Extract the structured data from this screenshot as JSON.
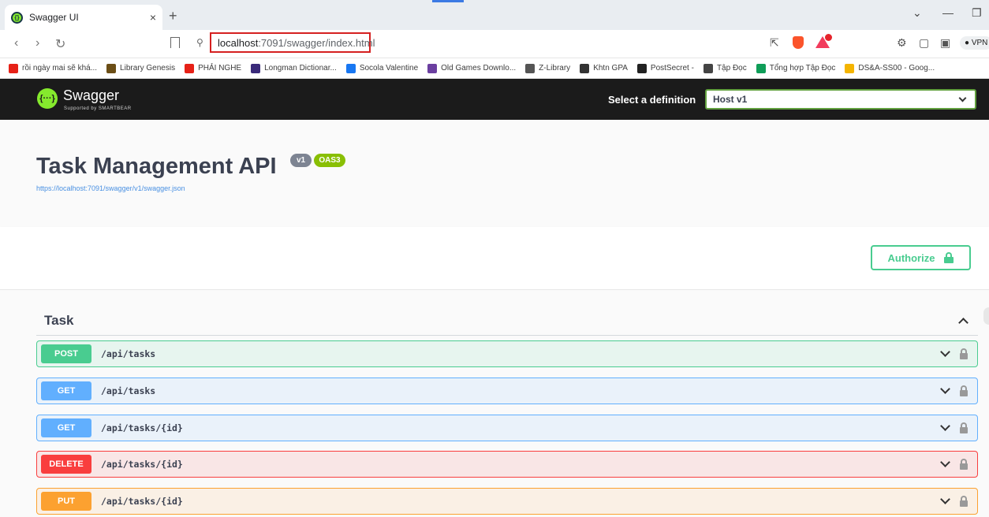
{
  "browser": {
    "tab_title": "Swagger UI",
    "tab_close": "×",
    "new_tab": "+",
    "url_host": "localhost",
    "url_path": ":7091/swagger/index.html",
    "vpn_label": "● VPN",
    "bookmarks": [
      {
        "label": "rồi ngày mai sẽ khá...",
        "color": "#e62117"
      },
      {
        "label": "Library Genesis",
        "color": "#6b4e16"
      },
      {
        "label": "PHẢI NGHE",
        "color": "#e62117"
      },
      {
        "label": "Longman Dictionar...",
        "color": "#3a2a7a"
      },
      {
        "label": "Socola Valentine",
        "color": "#1877f2"
      },
      {
        "label": "Old Games Downlo...",
        "color": "#6b3fa0"
      },
      {
        "label": "Z-Library",
        "color": "#555555"
      },
      {
        "label": "Khtn GPA",
        "color": "#333333"
      },
      {
        "label": "PostSecret -",
        "color": "#222222"
      },
      {
        "label": "Tập Đọc",
        "color": "#444444"
      },
      {
        "label": "Tổng hợp Tập Đọc",
        "color": "#0f9d58"
      },
      {
        "label": "DS&A-SS00 - Goog...",
        "color": "#f4b400"
      }
    ]
  },
  "swagger": {
    "brand": "Swagger",
    "brand_sub": "Supported by SMARTBEAR",
    "select_label": "Select a definition",
    "selected_definition": "Host v1"
  },
  "info": {
    "title": "Task Management API",
    "version_badge": "v1",
    "oas_badge": "OAS3",
    "spec_url": "https://localhost:7091/swagger/v1/swagger.json"
  },
  "auth": {
    "button_label": "Authorize"
  },
  "tag": {
    "name": "Task"
  },
  "operations": [
    {
      "method": "POST",
      "path": "/api/tasks"
    },
    {
      "method": "GET",
      "path": "/api/tasks"
    },
    {
      "method": "GET",
      "path": "/api/tasks/{id}"
    },
    {
      "method": "DELETE",
      "path": "/api/tasks/{id}"
    },
    {
      "method": "PUT",
      "path": "/api/tasks/{id}"
    }
  ],
  "colors": {
    "post": "#49cc90",
    "get": "#61affe",
    "delete": "#f93e3e",
    "put": "#fca130",
    "swagger_green": "#85ea2d"
  }
}
